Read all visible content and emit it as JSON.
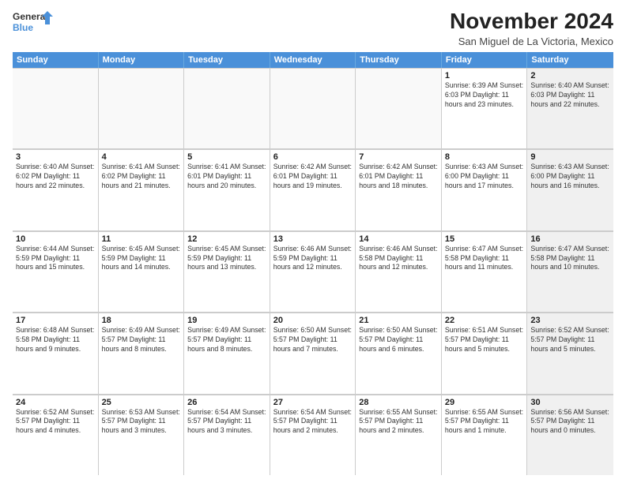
{
  "logo": {
    "line1": "General",
    "line2": "Blue"
  },
  "title": "November 2024",
  "location": "San Miguel de La Victoria, Mexico",
  "weekdays": [
    "Sunday",
    "Monday",
    "Tuesday",
    "Wednesday",
    "Thursday",
    "Friday",
    "Saturday"
  ],
  "rows": [
    [
      {
        "day": "",
        "info": "",
        "shaded": false,
        "empty": true
      },
      {
        "day": "",
        "info": "",
        "shaded": false,
        "empty": true
      },
      {
        "day": "",
        "info": "",
        "shaded": false,
        "empty": true
      },
      {
        "day": "",
        "info": "",
        "shaded": false,
        "empty": true
      },
      {
        "day": "",
        "info": "",
        "shaded": false,
        "empty": true
      },
      {
        "day": "1",
        "info": "Sunrise: 6:39 AM\nSunset: 6:03 PM\nDaylight: 11 hours and 23 minutes.",
        "shaded": false,
        "empty": false
      },
      {
        "day": "2",
        "info": "Sunrise: 6:40 AM\nSunset: 6:03 PM\nDaylight: 11 hours and 22 minutes.",
        "shaded": true,
        "empty": false
      }
    ],
    [
      {
        "day": "3",
        "info": "Sunrise: 6:40 AM\nSunset: 6:02 PM\nDaylight: 11 hours and 22 minutes.",
        "shaded": false,
        "empty": false
      },
      {
        "day": "4",
        "info": "Sunrise: 6:41 AM\nSunset: 6:02 PM\nDaylight: 11 hours and 21 minutes.",
        "shaded": false,
        "empty": false
      },
      {
        "day": "5",
        "info": "Sunrise: 6:41 AM\nSunset: 6:01 PM\nDaylight: 11 hours and 20 minutes.",
        "shaded": false,
        "empty": false
      },
      {
        "day": "6",
        "info": "Sunrise: 6:42 AM\nSunset: 6:01 PM\nDaylight: 11 hours and 19 minutes.",
        "shaded": false,
        "empty": false
      },
      {
        "day": "7",
        "info": "Sunrise: 6:42 AM\nSunset: 6:01 PM\nDaylight: 11 hours and 18 minutes.",
        "shaded": false,
        "empty": false
      },
      {
        "day": "8",
        "info": "Sunrise: 6:43 AM\nSunset: 6:00 PM\nDaylight: 11 hours and 17 minutes.",
        "shaded": false,
        "empty": false
      },
      {
        "day": "9",
        "info": "Sunrise: 6:43 AM\nSunset: 6:00 PM\nDaylight: 11 hours and 16 minutes.",
        "shaded": true,
        "empty": false
      }
    ],
    [
      {
        "day": "10",
        "info": "Sunrise: 6:44 AM\nSunset: 5:59 PM\nDaylight: 11 hours and 15 minutes.",
        "shaded": false,
        "empty": false
      },
      {
        "day": "11",
        "info": "Sunrise: 6:45 AM\nSunset: 5:59 PM\nDaylight: 11 hours and 14 minutes.",
        "shaded": false,
        "empty": false
      },
      {
        "day": "12",
        "info": "Sunrise: 6:45 AM\nSunset: 5:59 PM\nDaylight: 11 hours and 13 minutes.",
        "shaded": false,
        "empty": false
      },
      {
        "day": "13",
        "info": "Sunrise: 6:46 AM\nSunset: 5:59 PM\nDaylight: 11 hours and 12 minutes.",
        "shaded": false,
        "empty": false
      },
      {
        "day": "14",
        "info": "Sunrise: 6:46 AM\nSunset: 5:58 PM\nDaylight: 11 hours and 12 minutes.",
        "shaded": false,
        "empty": false
      },
      {
        "day": "15",
        "info": "Sunrise: 6:47 AM\nSunset: 5:58 PM\nDaylight: 11 hours and 11 minutes.",
        "shaded": false,
        "empty": false
      },
      {
        "day": "16",
        "info": "Sunrise: 6:47 AM\nSunset: 5:58 PM\nDaylight: 11 hours and 10 minutes.",
        "shaded": true,
        "empty": false
      }
    ],
    [
      {
        "day": "17",
        "info": "Sunrise: 6:48 AM\nSunset: 5:58 PM\nDaylight: 11 hours and 9 minutes.",
        "shaded": false,
        "empty": false
      },
      {
        "day": "18",
        "info": "Sunrise: 6:49 AM\nSunset: 5:57 PM\nDaylight: 11 hours and 8 minutes.",
        "shaded": false,
        "empty": false
      },
      {
        "day": "19",
        "info": "Sunrise: 6:49 AM\nSunset: 5:57 PM\nDaylight: 11 hours and 8 minutes.",
        "shaded": false,
        "empty": false
      },
      {
        "day": "20",
        "info": "Sunrise: 6:50 AM\nSunset: 5:57 PM\nDaylight: 11 hours and 7 minutes.",
        "shaded": false,
        "empty": false
      },
      {
        "day": "21",
        "info": "Sunrise: 6:50 AM\nSunset: 5:57 PM\nDaylight: 11 hours and 6 minutes.",
        "shaded": false,
        "empty": false
      },
      {
        "day": "22",
        "info": "Sunrise: 6:51 AM\nSunset: 5:57 PM\nDaylight: 11 hours and 5 minutes.",
        "shaded": false,
        "empty": false
      },
      {
        "day": "23",
        "info": "Sunrise: 6:52 AM\nSunset: 5:57 PM\nDaylight: 11 hours and 5 minutes.",
        "shaded": true,
        "empty": false
      }
    ],
    [
      {
        "day": "24",
        "info": "Sunrise: 6:52 AM\nSunset: 5:57 PM\nDaylight: 11 hours and 4 minutes.",
        "shaded": false,
        "empty": false
      },
      {
        "day": "25",
        "info": "Sunrise: 6:53 AM\nSunset: 5:57 PM\nDaylight: 11 hours and 3 minutes.",
        "shaded": false,
        "empty": false
      },
      {
        "day": "26",
        "info": "Sunrise: 6:54 AM\nSunset: 5:57 PM\nDaylight: 11 hours and 3 minutes.",
        "shaded": false,
        "empty": false
      },
      {
        "day": "27",
        "info": "Sunrise: 6:54 AM\nSunset: 5:57 PM\nDaylight: 11 hours and 2 minutes.",
        "shaded": false,
        "empty": false
      },
      {
        "day": "28",
        "info": "Sunrise: 6:55 AM\nSunset: 5:57 PM\nDaylight: 11 hours and 2 minutes.",
        "shaded": false,
        "empty": false
      },
      {
        "day": "29",
        "info": "Sunrise: 6:55 AM\nSunset: 5:57 PM\nDaylight: 11 hours and 1 minute.",
        "shaded": false,
        "empty": false
      },
      {
        "day": "30",
        "info": "Sunrise: 6:56 AM\nSunset: 5:57 PM\nDaylight: 11 hours and 0 minutes.",
        "shaded": true,
        "empty": false
      }
    ]
  ]
}
